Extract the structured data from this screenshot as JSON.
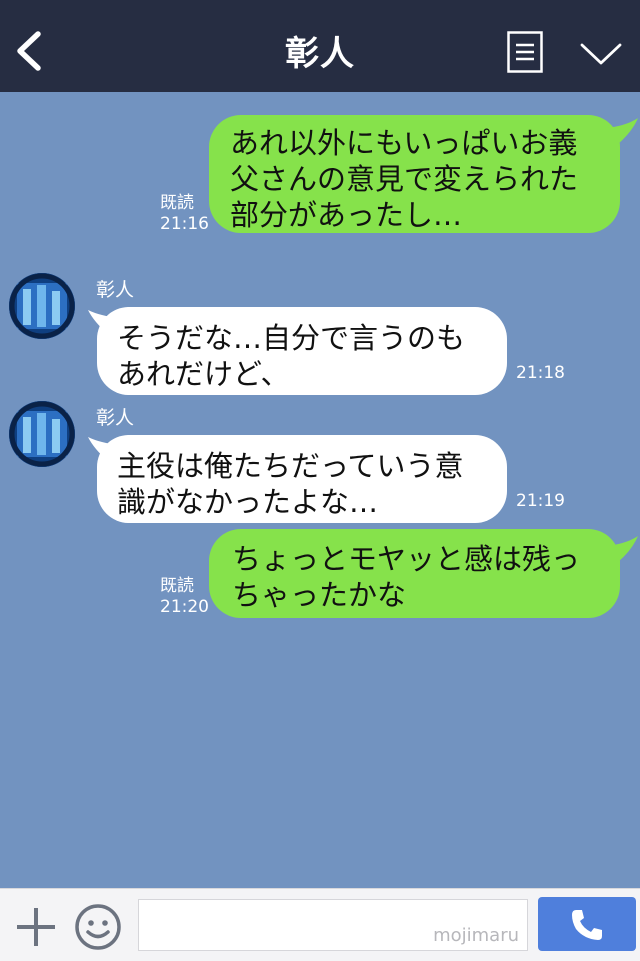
{
  "header": {
    "title": "彰人",
    "back_icon": "chevron-left-icon",
    "menu_icon": "notes-icon",
    "collapse_icon": "chevron-down-icon",
    "background": "#262d42"
  },
  "chat": {
    "background": "#7293c0",
    "messages": [
      {
        "direction": "outgoing",
        "text": "あれ以外にもいっぱいお義\n父さんの意見で変えられた\n部分があったし…",
        "read": "既読",
        "time": "21:16"
      },
      {
        "direction": "incoming",
        "sender": "彰人",
        "text": "そうだな…自分で言うのも\nあれだけど、",
        "time": "21:18"
      },
      {
        "direction": "incoming",
        "sender": "彰人",
        "text": "主役は俺たちだっていう意\n識がなかったよな…",
        "time": "21:19"
      },
      {
        "direction": "outgoing",
        "text": "ちょっとモヤッと感は残っ\nちゃったかな",
        "read": "既読",
        "time": "21:20"
      }
    ]
  },
  "input_bar": {
    "plus_icon": "plus-icon",
    "emoji_icon": "smile-icon",
    "placeholder": "",
    "watermark": "mojimaru",
    "call_icon": "phone-icon",
    "call_color": "#4f7fdc"
  },
  "colors": {
    "outgoing_bubble": "#86e24b",
    "incoming_bubble": "#ffffff"
  }
}
